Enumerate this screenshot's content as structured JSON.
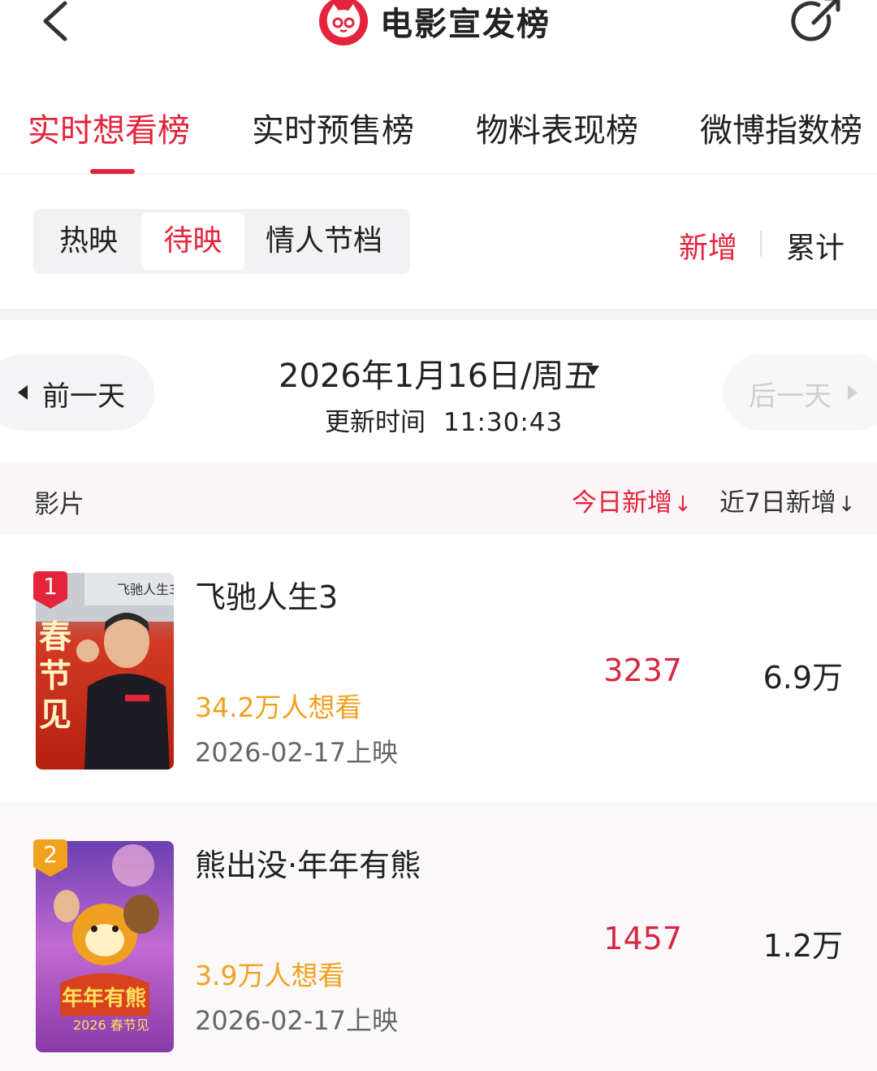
{
  "header": {
    "title": "电影宣发榜",
    "back_icon": "chevron-left-icon",
    "share_icon": "share-icon",
    "brand_color": "#e4243c"
  },
  "tabs": [
    {
      "label": "实时想看榜",
      "active": true
    },
    {
      "label": "实时预售榜",
      "active": false
    },
    {
      "label": "物料表现榜",
      "active": false
    },
    {
      "label": "微博指数榜",
      "active": false
    }
  ],
  "segment": {
    "options": [
      {
        "label": "热映",
        "active": false
      },
      {
        "label": "待映",
        "active": true
      },
      {
        "label": "情人节档",
        "active": false
      }
    ]
  },
  "toggle": {
    "new_label": "新增",
    "total_label": "累计",
    "selected": "新增"
  },
  "date_nav": {
    "prev_label": "前一天",
    "next_label": "后一天",
    "date": "2026年1月16日/周五",
    "update_label": "更新时间",
    "update_time": "11:30:43"
  },
  "columns": {
    "film": "影片",
    "today": "今日新增",
    "week": "近7日新增"
  },
  "movies": [
    {
      "rank": "1",
      "title": "飞驰人生3",
      "want": "34.2万人想看",
      "release": "2026-02-17上映",
      "today": "3237",
      "week": "6.9万",
      "poster_text": "春节见",
      "poster_logo": "飞驰人生3",
      "badge_color": "#e4243c"
    },
    {
      "rank": "2",
      "title": "熊出没·年年有熊",
      "want": "3.9万人想看",
      "release": "2026-02-17上映",
      "today": "1457",
      "week": "1.2万",
      "poster_text": "年年有熊",
      "poster_sub": "2026 春节见",
      "badge_color": "#f0a11e"
    }
  ]
}
